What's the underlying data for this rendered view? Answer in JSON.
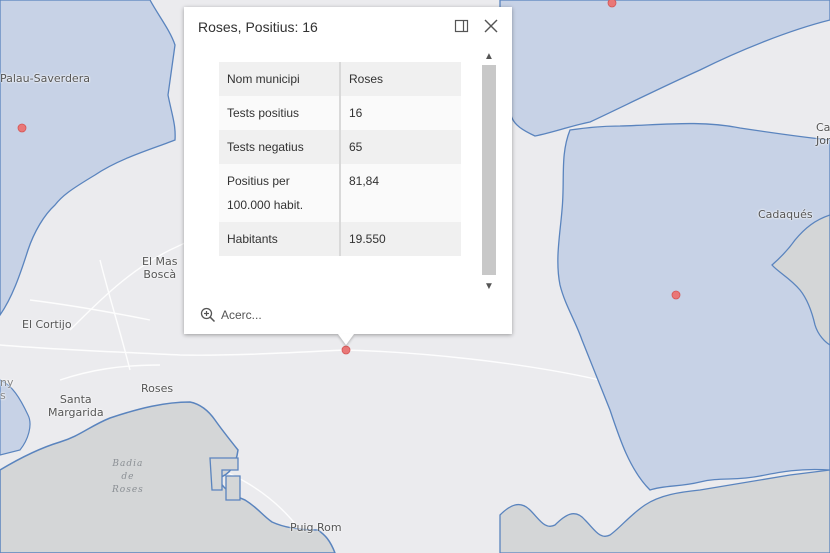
{
  "map": {
    "places": [
      {
        "id": "palau-saverdera",
        "text": "Palau-Saverdera"
      },
      {
        "id": "el-mas-bosca",
        "lines": [
          "El Mas",
          "Boscà"
        ]
      },
      {
        "id": "el-cortijo",
        "text": "El Cortijo"
      },
      {
        "id": "roses",
        "text": "Roses"
      },
      {
        "id": "santa-margarida",
        "lines": [
          "Santa",
          "Margarida"
        ]
      },
      {
        "id": "cadaques",
        "text": "Cadaqués"
      },
      {
        "id": "cala-jonca",
        "lines": [
          "Ca",
          "Jone"
        ]
      },
      {
        "id": "puig-rom",
        "text": "Puig Rom"
      },
      {
        "id": "edge-left",
        "lines": [
          "ny",
          "s"
        ]
      }
    ],
    "water_label": {
      "lines": [
        "Badia",
        "de",
        "Roses"
      ]
    },
    "colors": {
      "land": "#ebebee",
      "municipality_fill": "#c7d2e6",
      "boundary": "#5a84be",
      "sea": "#d4d6d7",
      "marker": "#e97777"
    }
  },
  "popup": {
    "title": "Roses, Positius: 16",
    "dock_icon": "dock-icon",
    "close_icon": "close-icon",
    "rows": [
      {
        "key": "Nom municipi",
        "value": "Roses"
      },
      {
        "key": "Tests positius",
        "value": "16"
      },
      {
        "key": "Tests negatius",
        "value": "65"
      },
      {
        "key_lines": [
          "Positius per",
          "100.000 habit."
        ],
        "value": "81,84"
      },
      {
        "key": "Habitants",
        "value": "19.550"
      }
    ],
    "zoom_label": "Acerc...",
    "zoom_icon": "zoom-in-icon",
    "scroll_up": "▲",
    "scroll_down": "▼"
  }
}
